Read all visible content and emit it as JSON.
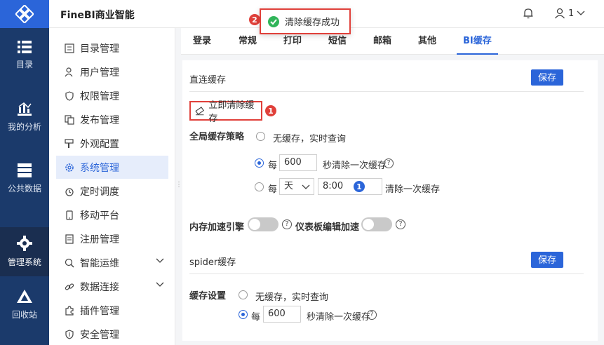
{
  "app": {
    "title": "FineBI商业智能"
  },
  "header": {
    "user_label": "1"
  },
  "toast": {
    "message": "清除缓存成功",
    "step": "2"
  },
  "rail": [
    {
      "label": "目录",
      "icon": "list-icon"
    },
    {
      "label": "我的分析",
      "icon": "chart-icon"
    },
    {
      "label": "公共数据",
      "icon": "database-icon"
    },
    {
      "label": "管理系统",
      "icon": "gear-icon"
    },
    {
      "label": "回收站",
      "icon": "recycle-icon"
    }
  ],
  "menu": [
    {
      "label": "目录管理"
    },
    {
      "label": "用户管理"
    },
    {
      "label": "权限管理"
    },
    {
      "label": "发布管理"
    },
    {
      "label": "外观配置"
    },
    {
      "label": "系统管理"
    },
    {
      "label": "定时调度"
    },
    {
      "label": "移动平台"
    },
    {
      "label": "注册管理"
    },
    {
      "label": "智能运维"
    },
    {
      "label": "数据连接"
    },
    {
      "label": "插件管理"
    },
    {
      "label": "安全管理"
    }
  ],
  "tabs": [
    "登录",
    "常规",
    "打印",
    "短信",
    "邮箱",
    "其他",
    "BI缓存"
  ],
  "direct_cache": {
    "title": "直连缓存",
    "save_label": "保存",
    "clear_label": "立即清除缓存",
    "clear_step": "1",
    "strategy_label": "全局缓存策略",
    "opt_none": "无缓存，实时查询",
    "opt_every_prefix": "每",
    "opt_every_value": "600",
    "opt_every_suffix": "秒清除一次缓存",
    "opt_daily_prefix": "每",
    "opt_daily_unit": "天",
    "opt_daily_time": "8:00",
    "opt_daily_step": "1",
    "opt_daily_suffix": "清除一次缓存",
    "memory_label": "内存加速引擎",
    "dashboard_label": "仪表板编辑加速"
  },
  "spider_cache": {
    "title": "spider缓存",
    "save_label": "保存",
    "setting_label": "缓存设置",
    "opt_none": "无缓存，实时查询",
    "opt_every_prefix": "每",
    "opt_every_value": "600",
    "opt_every_suffix": "秒清除一次缓存"
  }
}
